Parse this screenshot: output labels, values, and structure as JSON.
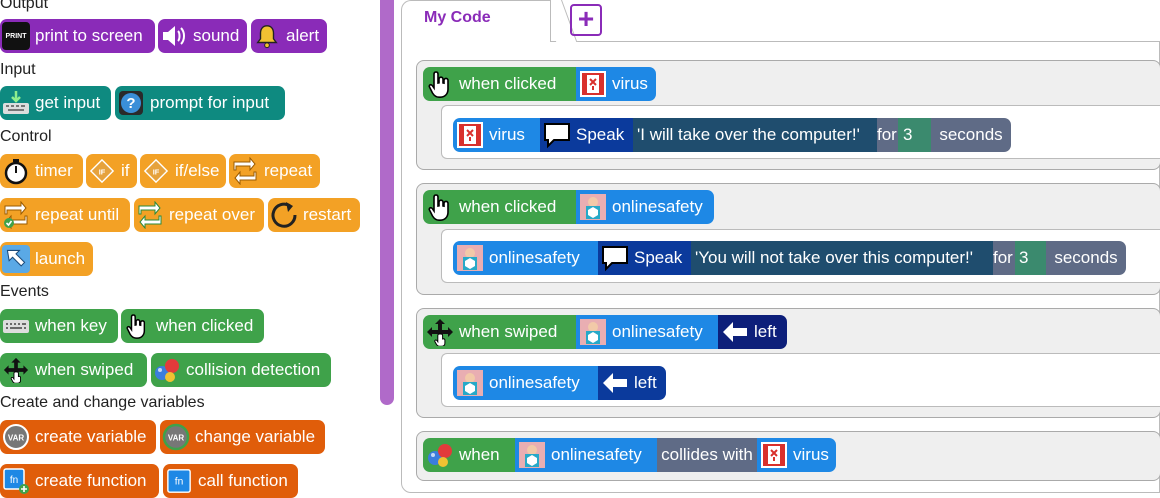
{
  "palette": {
    "output": {
      "title": "Output",
      "print": "print to screen",
      "print_icon_text": "PRINT",
      "sound": "sound",
      "alert": "alert"
    },
    "input": {
      "title": "Input",
      "get_input": "get input",
      "prompt": "prompt for input"
    },
    "control": {
      "title": "Control",
      "timer": "timer",
      "if": "if",
      "if_else": "if/else",
      "repeat": "repeat",
      "repeat_until": "repeat until",
      "repeat_over": "repeat over",
      "restart": "restart",
      "launch": "launch"
    },
    "events": {
      "title": "Events",
      "when_key": "when key",
      "when_clicked": "when clicked",
      "when_swiped": "when swiped",
      "collision": "collision detection"
    },
    "variables": {
      "title": "Create and change variables",
      "create_variable": "create variable",
      "change_variable": "change variable",
      "create_function": "create function",
      "call_function": "call function"
    }
  },
  "workspace": {
    "tab_label": "My Code",
    "add_label": "+",
    "scripts": [
      {
        "event": "when clicked",
        "sprite": "virus",
        "action_sprite": "virus",
        "verb": "Speak",
        "text": "'I will take over the computer!'",
        "for_label": "for",
        "num": "3",
        "unit": "seconds"
      },
      {
        "event": "when clicked",
        "sprite": "onlinesafety",
        "action_sprite": "onlinesafety",
        "verb": "Speak",
        "text": "'You will not take over this computer!'",
        "for_label": "for",
        "num": "3",
        "unit": "seconds"
      },
      {
        "event": "when swiped",
        "sprite": "onlinesafety",
        "dir": "left",
        "action_sprite": "onlinesafety",
        "action_dir": "left"
      },
      {
        "event": "when",
        "sprite": "onlinesafety",
        "collides": "collides with",
        "target": "virus"
      }
    ]
  },
  "colors": {
    "purple": "#8a2bb8",
    "teal": "#0e8a80",
    "orange": "#f3a125",
    "green": "#3fa24a",
    "dark_orange": "#e05d0a",
    "blue": "#1e88e5",
    "navy": "#0d1f7a",
    "divider": "#b06ac9"
  }
}
